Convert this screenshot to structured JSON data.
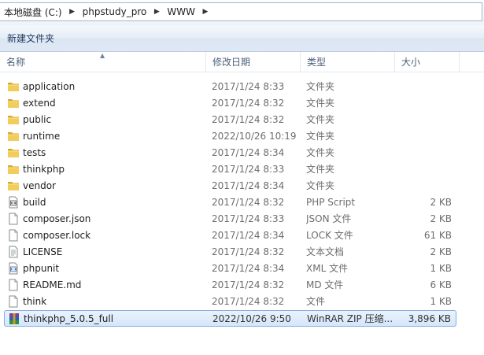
{
  "breadcrumb": [
    "本地磁盘 (C:)",
    "phpstudy_pro",
    "WWW"
  ],
  "toolbar": {
    "new_folder": "新建文件夹"
  },
  "columns": {
    "name": "名称",
    "date": "修改日期",
    "type": "类型",
    "size": "大小"
  },
  "files": [
    {
      "name": "application",
      "date": "2017/1/24 8:33",
      "type": "文件夹",
      "size": "",
      "icon": "folder-icon"
    },
    {
      "name": "extend",
      "date": "2017/1/24 8:32",
      "type": "文件夹",
      "size": "",
      "icon": "folder-icon"
    },
    {
      "name": "public",
      "date": "2017/1/24 8:32",
      "type": "文件夹",
      "size": "",
      "icon": "folder-icon"
    },
    {
      "name": "runtime",
      "date": "2022/10/26 10:19",
      "type": "文件夹",
      "size": "",
      "icon": "folder-icon"
    },
    {
      "name": "tests",
      "date": "2017/1/24 8:34",
      "type": "文件夹",
      "size": "",
      "icon": "folder-icon"
    },
    {
      "name": "thinkphp",
      "date": "2017/1/24 8:33",
      "type": "文件夹",
      "size": "",
      "icon": "folder-icon"
    },
    {
      "name": "vendor",
      "date": "2017/1/24 8:34",
      "type": "文件夹",
      "size": "",
      "icon": "folder-icon"
    },
    {
      "name": "build",
      "date": "2017/1/24 8:32",
      "type": "PHP Script",
      "size": "2 KB",
      "icon": "php-script-icon"
    },
    {
      "name": "composer.json",
      "date": "2017/1/24 8:33",
      "type": "JSON 文件",
      "size": "2 KB",
      "icon": "file-icon"
    },
    {
      "name": "composer.lock",
      "date": "2017/1/24 8:34",
      "type": "LOCK 文件",
      "size": "61 KB",
      "icon": "file-icon"
    },
    {
      "name": "LICENSE",
      "date": "2017/1/24 8:32",
      "type": "文本文档",
      "size": "2 KB",
      "icon": "text-file-icon"
    },
    {
      "name": "phpunit",
      "date": "2017/1/24 8:34",
      "type": "XML 文件",
      "size": "1 KB",
      "icon": "xml-file-icon"
    },
    {
      "name": "README.md",
      "date": "2017/1/24 8:32",
      "type": "MD 文件",
      "size": "6 KB",
      "icon": "file-icon"
    },
    {
      "name": "think",
      "date": "2017/1/24 8:32",
      "type": "文件",
      "size": "1 KB",
      "icon": "file-icon"
    },
    {
      "name": "thinkphp_5.0.5_full",
      "date": "2022/10/26 9:50",
      "type": "WinRAR ZIP 压缩...",
      "size": "3,896 KB",
      "icon": "winrar-archive-icon",
      "selected": true
    }
  ],
  "colors": {
    "selection_border": "#84acdd",
    "selection_fill": "#d4e6fb",
    "folder": "#e8c35a"
  }
}
